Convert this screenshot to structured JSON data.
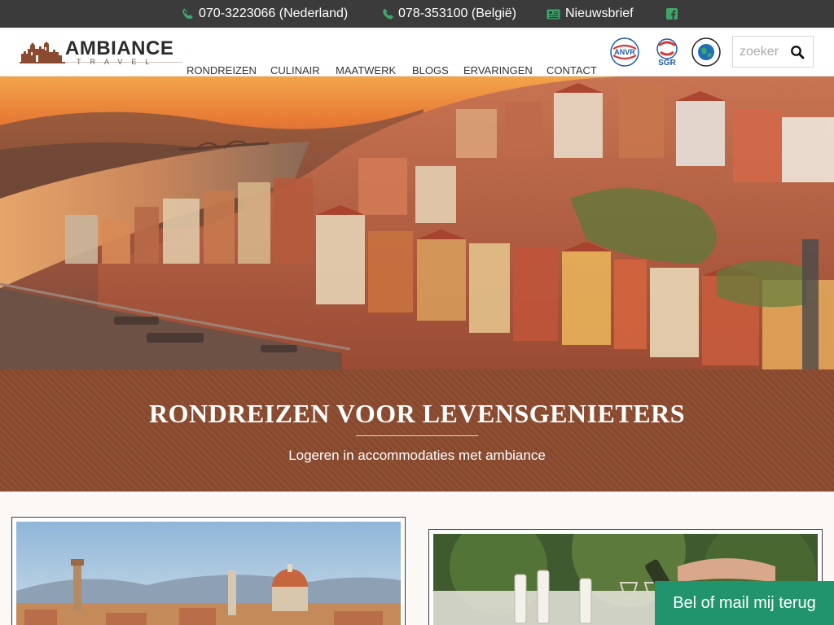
{
  "topbar": {
    "phone_nl": "070-3223066 (Nederland)",
    "phone_be": "078-353100 (België)",
    "newsletter": "Nieuwsbrief",
    "icons": [
      "phone-icon",
      "phone-icon",
      "newspaper-icon",
      "facebook-icon"
    ]
  },
  "header": {
    "logo": {
      "brand": "AMBIANCE",
      "sub": "TRAVEL"
    },
    "nav": [
      "RONDREIZEN",
      "CULINAIR",
      "MAATWERK",
      "BLOGS",
      "ERVARINGEN",
      "CONTACT"
    ],
    "badges": [
      "ANVR",
      "SGR",
      "Calamiteitenfonds"
    ],
    "search": {
      "placeholder": "zoeker"
    }
  },
  "banner": {
    "title": "RONDREIZEN VOOR LEVENSGENIETERS",
    "subtitle": "Logeren in accommodaties met ambiance"
  },
  "callback": {
    "label": "Bel of mail mij terug"
  },
  "colors": {
    "accent": "#22946d",
    "banner": "#8b4b30",
    "topbar": "#3b3b3b"
  }
}
